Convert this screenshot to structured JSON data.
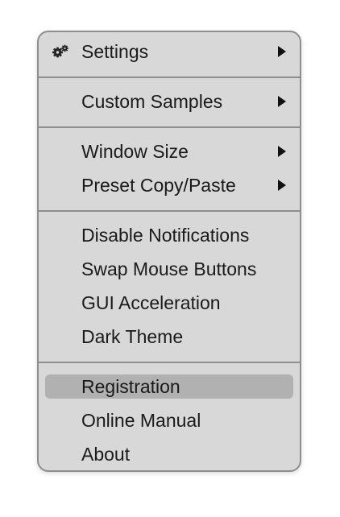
{
  "menu": {
    "items": [
      {
        "label": "Settings",
        "icon": "gears-icon",
        "submenu": true
      },
      {
        "label": "Custom Samples",
        "submenu": true
      },
      {
        "label": "Window Size",
        "submenu": true
      },
      {
        "label": "Preset Copy/Paste",
        "submenu": true
      },
      {
        "label": "Disable Notifications"
      },
      {
        "label": "Swap Mouse Buttons"
      },
      {
        "label": "GUI Acceleration"
      },
      {
        "label": "Dark Theme"
      },
      {
        "label": "Registration",
        "highlighted": true
      },
      {
        "label": "Online Manual"
      },
      {
        "label": "About"
      }
    ],
    "colors": {
      "background": "#d8d8d8",
      "highlight": "#b1b1b1",
      "border": "#8e8e8e",
      "text": "#1a1a1a"
    }
  }
}
